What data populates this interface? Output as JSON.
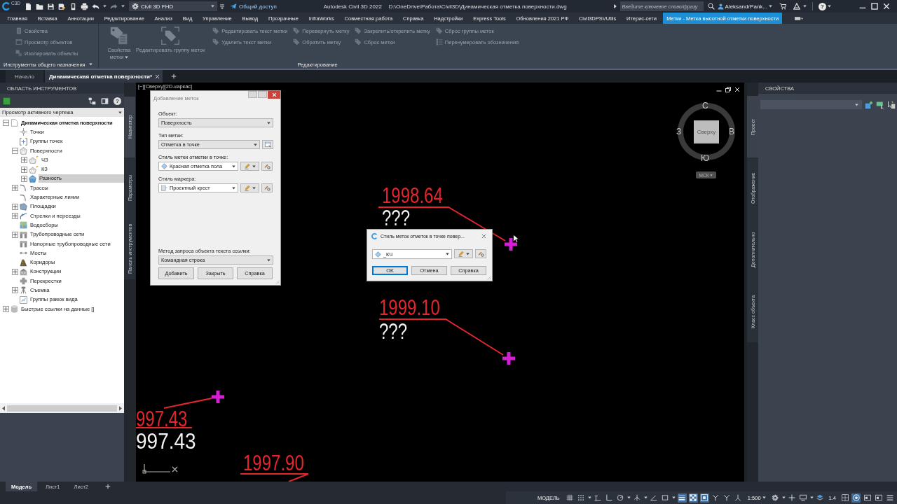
{
  "title_bar": {
    "app_badge": "C3D",
    "workspace": "Civil 3D FHD",
    "share": "Общий доступ",
    "app_title": "Autodesk Civil 3D 2022",
    "file_path": "D:\\OneDrive\\Работа\\Civil3D\\Динамическая отметка поверхности.dwg",
    "search": {
      "placeholder": "Введите ключевое слово/фразу"
    },
    "user": "AleksandrPank...",
    "help": "?"
  },
  "ribbon_tabs": [
    {
      "label": "Главная",
      "selected": false
    },
    {
      "label": "Вставка",
      "selected": false
    },
    {
      "label": "Аннотации",
      "selected": false
    },
    {
      "label": "Редактирование",
      "selected": false
    },
    {
      "label": "Анализ",
      "selected": false
    },
    {
      "label": "Вид",
      "selected": false
    },
    {
      "label": "Управление",
      "selected": false
    },
    {
      "label": "Вывод",
      "selected": false
    },
    {
      "label": "Прозрачные",
      "selected": false
    },
    {
      "label": "InfraWorks",
      "selected": false
    },
    {
      "label": "Совместная работа",
      "selected": false
    },
    {
      "label": "Справка",
      "selected": false
    },
    {
      "label": "Надстройки",
      "selected": false
    },
    {
      "label": "Express Tools",
      "selected": false
    },
    {
      "label": "Обновления 2021 РФ",
      "selected": false
    },
    {
      "label": "Civil3DPSVUtils",
      "selected": false
    },
    {
      "label": "Итерис-сети",
      "selected": false
    },
    {
      "label": "Метки - Метка высотной отметки поверхности",
      "selected": true
    }
  ],
  "ribbon": {
    "general_panel": {
      "title": "Инструменты общего назначения",
      "has_menu": true,
      "items": [
        {
          "label": "Свойства",
          "disabled": true
        },
        {
          "label": "Просмотр объектов",
          "disabled": true
        },
        {
          "label": "Изолировать объекты",
          "disabled": true
        }
      ]
    },
    "edit_panel": {
      "title": "Редактирование",
      "large_buttons": [
        {
          "label": "Свойства метки",
          "dropdown": true,
          "disabled": true
        },
        {
          "label": "Редактировать группу меток",
          "dropdown": false,
          "disabled": true
        }
      ],
      "columns": [
        [
          {
            "label": "Редактировать текст метки",
            "disabled": true
          },
          {
            "label": "Удалить текст метки",
            "disabled": true
          }
        ],
        [
          {
            "label": "Перевернуть метку",
            "disabled": true
          },
          {
            "label": "Обратить метку",
            "disabled": true
          }
        ],
        [
          {
            "label": "Закрепить/открепить метку",
            "disabled": true
          },
          {
            "label": "Сброс метки",
            "disabled": true
          }
        ],
        [
          {
            "label": "Сброс группы меток",
            "disabled": true
          },
          {
            "label": "Перенумеровать обозначения",
            "disabled": true
          }
        ]
      ]
    }
  },
  "document_tabs": [
    {
      "label": "Начало",
      "selected": false
    },
    {
      "label": "Динамическая отметка поверхности*",
      "selected": true
    }
  ],
  "toolspace": {
    "title": "ОБЛАСТЬ ИНСТРУМЕНТОВ",
    "help": "?",
    "view": "Просмотр активного чертежа",
    "tree": [
      {
        "label": "Динамическая отметка поверхности",
        "expandable": true,
        "expanded": true,
        "selected": false,
        "children": [
          {
            "label": "Точки",
            "expandable": false,
            "expanded": false,
            "selected": false
          },
          {
            "label": "Группы точек",
            "expandable": false,
            "expanded": false,
            "selected": false
          },
          {
            "label": "Поверхности",
            "expandable": true,
            "expanded": true,
            "selected": false,
            "children": [
              {
                "label": "ЧЗ",
                "expandable": true,
                "expanded": false,
                "selected": false
              },
              {
                "label": "КЗ",
                "expandable": true,
                "expanded": false,
                "selected": false
              },
              {
                "label": "Разность",
                "expandable": true,
                "expanded": false,
                "selected": true
              }
            ]
          },
          {
            "label": "Трассы",
            "expandable": true,
            "expanded": false,
            "selected": false
          },
          {
            "label": "Характерные линии",
            "expandable": false,
            "expanded": false,
            "selected": false
          },
          {
            "label": "Площадки",
            "expandable": true,
            "expanded": false,
            "selected": false
          },
          {
            "label": "Стрелки и переезды",
            "expandable": true,
            "expanded": false,
            "selected": false
          },
          {
            "label": "Водосборы",
            "expandable": false,
            "expanded": false,
            "selected": false
          },
          {
            "label": "Трубопроводные сети",
            "expandable": true,
            "expanded": false,
            "selected": false
          },
          {
            "label": "Напорные трубопроводные сети",
            "expandable": false,
            "expanded": false,
            "selected": false
          },
          {
            "label": "Мосты",
            "expandable": false,
            "expanded": false,
            "selected": false
          },
          {
            "label": "Коридоры",
            "expandable": false,
            "expanded": false,
            "selected": false
          },
          {
            "label": "Конструкции",
            "expandable": true,
            "expanded": false,
            "selected": false
          },
          {
            "label": "Перекрестки",
            "expandable": false,
            "expanded": false,
            "selected": false
          },
          {
            "label": "Съемка",
            "expandable": true,
            "expanded": false,
            "selected": false
          },
          {
            "label": "Группы рамок вида",
            "expandable": false,
            "expanded": false,
            "selected": false
          }
        ]
      },
      {
        "label": "Быстрые ссылки на данные []",
        "expandable": true,
        "expanded": false,
        "selected": false
      }
    ],
    "side_tabs": [
      {
        "label": "Навигатор",
        "selected": true
      },
      {
        "label": "Параметры",
        "selected": false
      },
      {
        "label": "Панель инструментов",
        "selected": false
      }
    ]
  },
  "viewport": {
    "label": "[−][Сверху][2D-каркас]",
    "viewcube": {
      "face": "Сверху",
      "north": "С",
      "east": "В",
      "south": "Ю",
      "west": "З",
      "ucs": "МСК"
    },
    "annotations": [
      {
        "elevation": "1998.64",
        "note": "???"
      },
      {
        "elevation": "1999.10",
        "note": "???"
      },
      {
        "elevation": "997.43",
        "note": "997.43"
      },
      {
        "elevation": "1997.90"
      }
    ]
  },
  "add_labels_dialog": {
    "title": "Добавление меток",
    "active": false,
    "fields": [
      {
        "label": "Объект:",
        "value": "Поверхность",
        "kind": "plain"
      },
      {
        "label": "Тип метки:",
        "value": "Отметка в точке",
        "kind": "browse"
      },
      {
        "label": "Стиль метки отметки в точке:",
        "value": "Красная отметка пола",
        "kind": "style"
      },
      {
        "label": "Стиль маркера:",
        "value": "Проектный крест",
        "kind": "style"
      }
    ],
    "reference_field": {
      "label": "Метод запроса объекта текста ссылки:",
      "value": "Командная строка"
    },
    "buttons": [
      "Добавить",
      "Закрыть",
      "Справка"
    ]
  },
  "style_dialog": {
    "title": "Стиль меток отметок в точке повер...",
    "value": "_КЧ",
    "buttons": [
      {
        "label": "OK",
        "default": true
      },
      {
        "label": "Отмена",
        "default": false
      },
      {
        "label": "Справка",
        "default": false
      }
    ]
  },
  "properties": {
    "title": "СВОЙСТВА",
    "tabs": [
      {
        "label": "Проект",
        "selected": true
      },
      {
        "label": "Отображение",
        "selected": false
      },
      {
        "label": "Дополнительно",
        "selected": false
      },
      {
        "label": "Класс объекта",
        "selected": false
      }
    ]
  },
  "layout_tabs": [
    {
      "label": "Модель",
      "selected": true
    },
    {
      "label": "Лист1",
      "selected": false
    },
    {
      "label": "Лист2",
      "selected": false
    }
  ],
  "status_bar": {
    "space": "МОДЕЛЬ",
    "drafting": [
      {
        "on": false,
        "menu": false
      },
      {
        "on": false,
        "menu": true
      },
      {
        "on": false,
        "menu": false
      },
      {
        "on": false,
        "menu": false
      },
      {
        "on": false,
        "menu": true
      },
      {
        "on": false,
        "menu": true
      },
      {
        "on": false,
        "menu": false
      },
      {
        "on": false,
        "menu": true
      },
      {
        "on": true,
        "menu": false
      },
      {
        "on": true,
        "menu": false
      },
      {
        "on": true,
        "menu": false
      },
      {
        "on": false,
        "menu": false
      },
      {
        "on": false,
        "menu": false
      },
      {
        "on": false,
        "menu": false
      }
    ],
    "scale": "1:500",
    "tools": [
      {
        "on": false,
        "menu": true
      },
      {
        "on": false,
        "menu": false
      },
      {
        "on": false,
        "menu": true
      },
      {
        "on": false,
        "menu": false
      }
    ],
    "readout": "1.4",
    "display": [
      {
        "on": false,
        "menu": false
      },
      {
        "on": true,
        "menu": false
      },
      {
        "on": false,
        "menu": false
      },
      {
        "on": false,
        "menu": false
      },
      {
        "on": false,
        "menu": false
      }
    ]
  }
}
